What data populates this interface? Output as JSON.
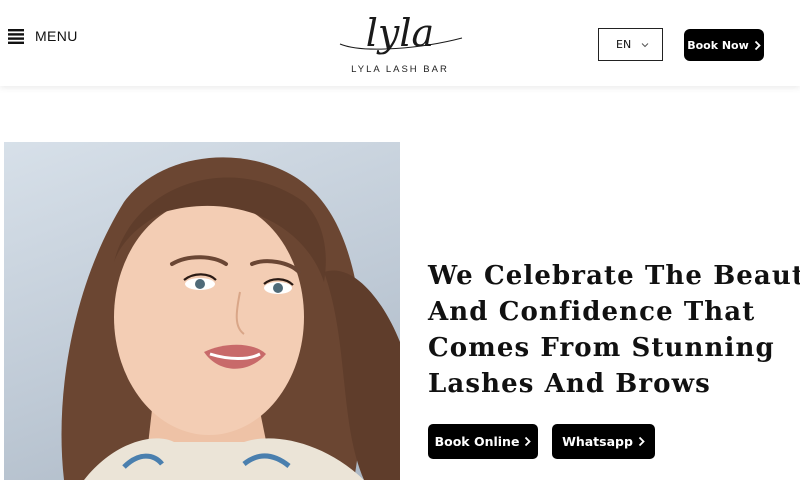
{
  "header": {
    "menu_label": "MENU",
    "logo_script": "lyla",
    "logo_tagline": "LYLA LASH BAR",
    "language": "EN",
    "book_now_label": "Book Now"
  },
  "hero": {
    "headline_lines": [
      "We Celebrate The Beauty",
      "And Confidence That",
      "Comes From Stunning",
      "Lashes And Brows"
    ],
    "book_online_label": "Book Online",
    "whatsapp_label": "Whatsapp"
  },
  "colors": {
    "primary": "#000000",
    "background": "#ffffff",
    "text": "#111111"
  },
  "icons": [
    "menu-icon",
    "chevron-down-icon",
    "chevron-right-icon"
  ]
}
